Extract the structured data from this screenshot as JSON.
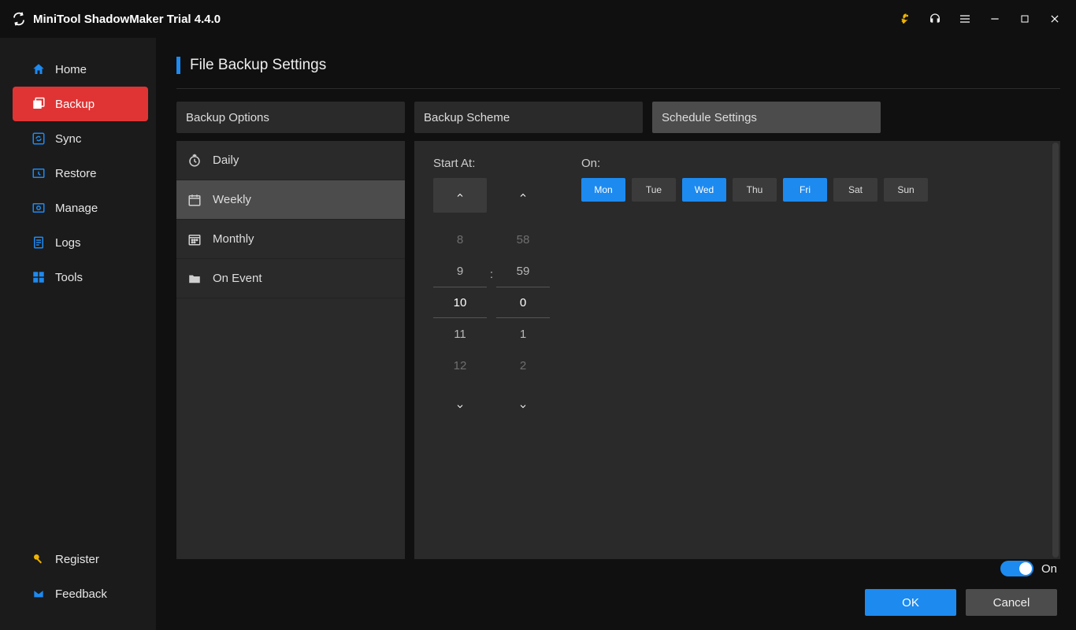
{
  "app": {
    "title": "MiniTool ShadowMaker Trial 4.4.0"
  },
  "sidebar": {
    "items": [
      {
        "label": "Home"
      },
      {
        "label": "Backup"
      },
      {
        "label": "Sync"
      },
      {
        "label": "Restore"
      },
      {
        "label": "Manage"
      },
      {
        "label": "Logs"
      },
      {
        "label": "Tools"
      }
    ],
    "bottom": [
      {
        "label": "Register"
      },
      {
        "label": "Feedback"
      }
    ]
  },
  "page": {
    "title": "File Backup Settings"
  },
  "topTabs": [
    {
      "label": "Backup Options"
    },
    {
      "label": "Backup Scheme"
    },
    {
      "label": "Schedule Settings"
    }
  ],
  "scheduleTabs": [
    {
      "label": "Daily"
    },
    {
      "label": "Weekly"
    },
    {
      "label": "Monthly"
    },
    {
      "label": "On Event"
    }
  ],
  "schedule": {
    "startAtLabel": "Start At:",
    "onLabel": "On:",
    "hours": [
      "8",
      "9",
      "10",
      "11",
      "12"
    ],
    "minutes": [
      "58",
      "59",
      "0",
      "1",
      "2"
    ],
    "colon": ":",
    "days": [
      {
        "label": "Mon",
        "on": true
      },
      {
        "label": "Tue",
        "on": false
      },
      {
        "label": "Wed",
        "on": true
      },
      {
        "label": "Thu",
        "on": false
      },
      {
        "label": "Fri",
        "on": true
      },
      {
        "label": "Sat",
        "on": false
      },
      {
        "label": "Sun",
        "on": false
      }
    ]
  },
  "footer": {
    "toggleLabel": "On",
    "ok": "OK",
    "cancel": "Cancel"
  }
}
